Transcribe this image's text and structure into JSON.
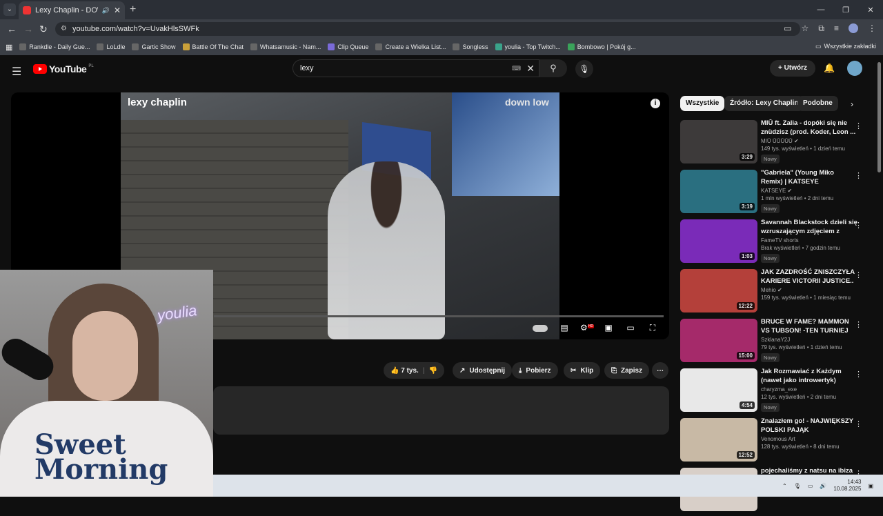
{
  "browser": {
    "tab_title": "Lexy Chaplin - DOWN LOW",
    "tab_sound_icon": "speaker-icon",
    "url": "youtube.com/watch?v=UvakHlsSWFk",
    "bookmarks": [
      "Rankdle - Daily Gue...",
      "LoLdle",
      "Gartic Show",
      "Battle Of The Chat",
      "Whatsamusic - Nam...",
      "Clip Queue",
      "Create a Wielka List...",
      "Songless",
      "youlia - Top Twitch...",
      "Bombowo | Pokój g..."
    ],
    "all_bookmarks": "Wszystkie zakładki"
  },
  "youtube": {
    "logo_text": "YouTube",
    "logo_region": "PL",
    "search_value": "lexy",
    "create_label": "Utwórz"
  },
  "video": {
    "overlay_title": "lexy chaplin",
    "overlay_sub": "down low",
    "info_glyph": "i",
    "hd_badge": "HD"
  },
  "actions": {
    "likes": "7 tys.",
    "share": "Udostępnij",
    "download": "Pobierz",
    "clip": "Klip",
    "save": "Zapisz"
  },
  "chips": [
    "Wszystkie",
    "Źródło: Lexy Chaplin",
    "Podobne"
  ],
  "recommendations": [
    {
      "title": "MIŪ ft. Zalia - dopóki się nie znüdzisz (prod. Koder, Leon ...",
      "channel": "MIŪ ŪŪŪŪŪ",
      "verified": true,
      "meta": "149 tys. wyświetleń • 1 dzień temu",
      "badge": "Nowy",
      "duration": "3:29",
      "color": "#3d3a3a"
    },
    {
      "title": "\"Gabriela\" (Young Miko Remix) | KATSEYE",
      "channel": "KATSEYE",
      "verified": true,
      "meta": "1 mln wyświetleń • 2 dni temu",
      "badge": "Nowy",
      "duration": "3:19",
      "color": "#2a6f80"
    },
    {
      "title": "Savannah Blackstock dzieli się wzruszającym zdjęciem z ojce...",
      "channel": "FameTV shorts",
      "verified": false,
      "meta": "Brak wyświetleń • 7 godzin temu",
      "badge": "Nowy",
      "duration": "1:03",
      "color": "#7a2bb8"
    },
    {
      "title": "JAK ZAZDROŚĆ ZNISZCZYŁA KARIERE VICTORII JUSTICE..",
      "channel": "Mehio",
      "verified": true,
      "meta": "159 tys. wyświetleń • 1 miesiąc temu",
      "badge": "",
      "duration": "12:22",
      "color": "#b4403a"
    },
    {
      "title": "BRUCE W FAME? MAMMON VS TUBSON! -TEN TURNIEJ JEST ...",
      "channel": "SzklanaY2J",
      "verified": false,
      "meta": "79 tys. wyświetleń • 1 dzień temu",
      "badge": "Nowy",
      "duration": "15:00",
      "color": "#a52a6a"
    },
    {
      "title": "Jak Rozmawiać z Każdym (nawet jako introwertyk)",
      "channel": "charyzma_exe",
      "verified": false,
      "meta": "12 tys. wyświetleń • 2 dni temu",
      "badge": "Nowy",
      "duration": "4:54",
      "color": "#e8e8e8"
    },
    {
      "title": "Znalazłem go! - NAJWIĘKSZY POLSKI PAJĄK",
      "channel": "Venomous Art",
      "verified": false,
      "meta": "128 tys. wyświetleń • 8 dni temu",
      "badge": "",
      "duration": "12:52",
      "color": "#c8b9a5"
    },
    {
      "title": "pojechaliśmy z natsu na ibiza",
      "channel": "",
      "verified": false,
      "meta": "",
      "badge": "",
      "duration": "",
      "color": "#d8cfc8"
    }
  ],
  "webcam": {
    "neon_text": "youlia",
    "shirt_text": "Sweet Morning"
  },
  "taskbar": {
    "time": "14:43",
    "date": "10.08.2025"
  }
}
